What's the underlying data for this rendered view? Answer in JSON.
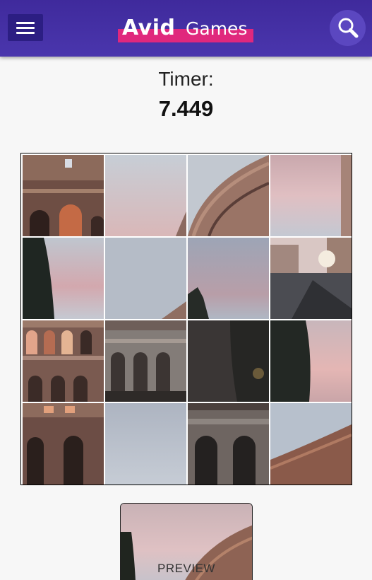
{
  "header": {
    "logo_avid": "Avid",
    "logo_games": "Games",
    "brand_colors": {
      "bar": "#3f2a9c",
      "accent": "#e0287d"
    },
    "menu_icon": "hamburger-menu-icon",
    "search_icon": "magnifying-glass-icon"
  },
  "timer": {
    "label": "Timer:",
    "value": "7.449"
  },
  "puzzle": {
    "rows": 4,
    "cols": 4,
    "tiles": [
      "colosseum-arches-wall",
      "pink-sky",
      "colosseum-top-curve",
      "pink-sky-building-edge",
      "tree-pink-sky",
      "cloudy-sky-wall-corner",
      "cloudy-sky-treetop",
      "street-view",
      "colosseum-arches-rows",
      "colosseum-arches-lower",
      "dark-tree",
      "tree-sunset-sky",
      "colosseum-arches-left",
      "pale-sky",
      "colosseum-arches-close",
      "sky-colosseum-edge"
    ]
  },
  "preview": {
    "label": "PREVIEW"
  }
}
